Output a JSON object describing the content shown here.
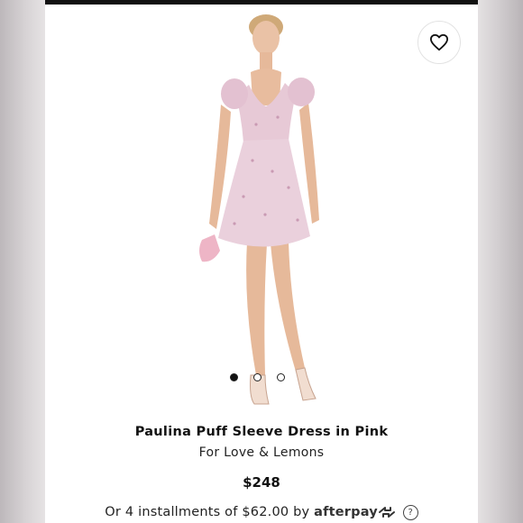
{
  "product": {
    "title": "Paulina Puff Sleeve Dress in Pink",
    "brand": "For Love & Lemons",
    "price": "$248"
  },
  "installments": {
    "prefix": "Or 4 installments of",
    "amount": "$62.00",
    "by": "by",
    "provider": "afterpay",
    "help_symbol": "?"
  },
  "gallery": {
    "image_count": 3,
    "active_index": 0
  },
  "icons": {
    "favorite": "heart-icon",
    "provider_mark": "afterpay-arrows-icon",
    "help": "question-circle-icon"
  },
  "colors": {
    "dress": "#e7c9d6",
    "bag": "#eeb5c6",
    "text": "#111111"
  }
}
